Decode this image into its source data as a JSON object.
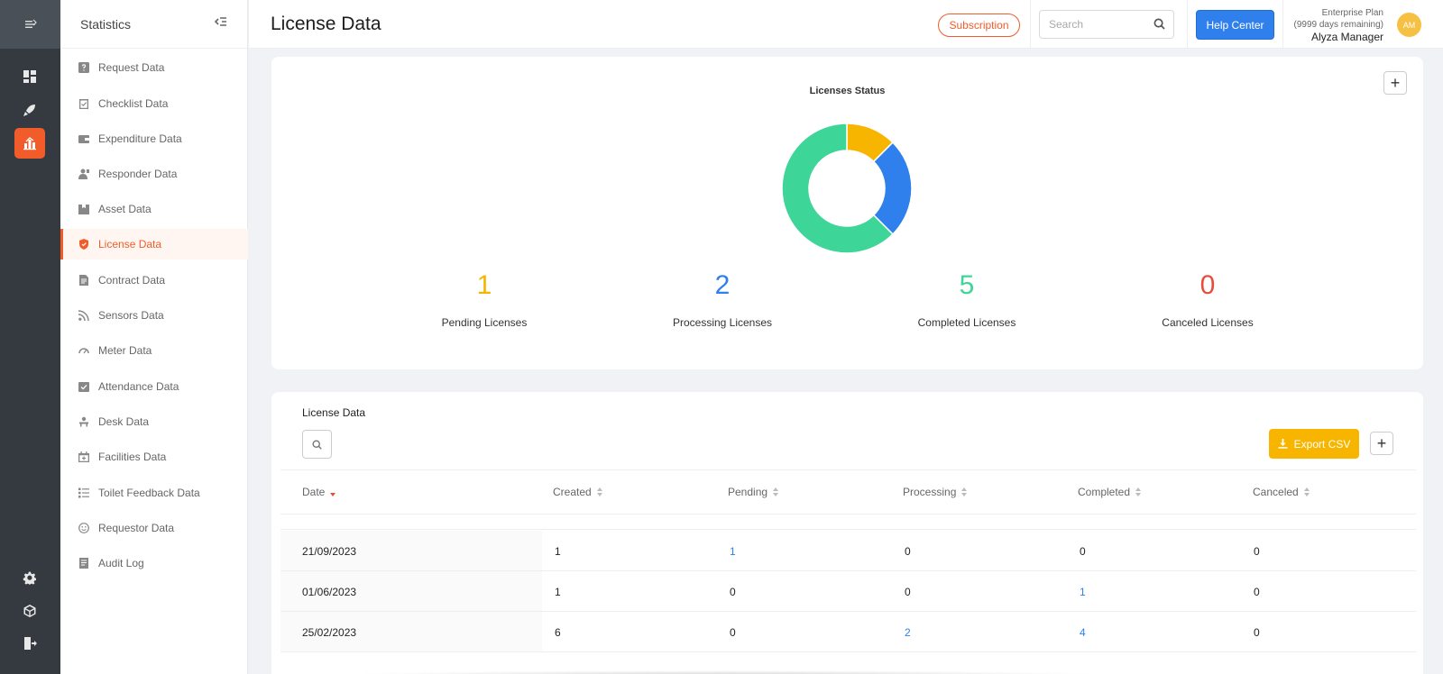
{
  "rail": {
    "items": [
      {
        "icon": "menu-expand-icon"
      },
      {
        "icon": "dashboard-icon"
      },
      {
        "icon": "rocket-icon"
      },
      {
        "icon": "statistics-icon"
      },
      {
        "icon": "gear-icon"
      },
      {
        "icon": "box-icon"
      },
      {
        "icon": "logout-icon"
      }
    ]
  },
  "sidebar": {
    "title": "Statistics",
    "items": [
      {
        "label": "Request Data",
        "icon": "question-icon"
      },
      {
        "label": "Checklist Data",
        "icon": "checklist-icon"
      },
      {
        "label": "Expenditure Data",
        "icon": "wallet-icon"
      },
      {
        "label": "Responder Data",
        "icon": "responder-icon"
      },
      {
        "label": "Asset Data",
        "icon": "asset-icon"
      },
      {
        "label": "License Data",
        "icon": "shield-icon",
        "active": true
      },
      {
        "label": "Contract Data",
        "icon": "contract-icon"
      },
      {
        "label": "Sensors Data",
        "icon": "sensor-icon"
      },
      {
        "label": "Meter Data",
        "icon": "meter-icon"
      },
      {
        "label": "Attendance Data",
        "icon": "attendance-icon"
      },
      {
        "label": "Desk Data",
        "icon": "desk-icon"
      },
      {
        "label": "Facilities Data",
        "icon": "facilities-icon"
      },
      {
        "label": "Toilet Feedback Data",
        "icon": "list-icon"
      },
      {
        "label": "Requestor Data",
        "icon": "smiley-icon"
      },
      {
        "label": "Audit Log",
        "icon": "log-icon"
      }
    ]
  },
  "header": {
    "title": "License Data",
    "subscription_label": "Subscription",
    "search_placeholder": "Search",
    "help_label": "Help Center",
    "plan": "Enterprise Plan",
    "days_remaining": "(9999 days remaining)",
    "user_name": "Alyza Manager",
    "avatar_initials": "AM"
  },
  "status": {
    "chart_title": "Licenses Status",
    "stats": [
      {
        "value": "1",
        "label": "Pending Licenses",
        "color": "#f8b500"
      },
      {
        "value": "2",
        "label": "Processing Licenses",
        "color": "#2f80ed"
      },
      {
        "value": "5",
        "label": "Completed Licenses",
        "color": "#3ed598"
      },
      {
        "value": "0",
        "label": "Canceled Licenses",
        "color": "#e74c3c"
      }
    ]
  },
  "chart_data": {
    "type": "pie",
    "title": "Licenses Status",
    "categories": [
      "Pending",
      "Processing",
      "Completed",
      "Canceled"
    ],
    "values": [
      1,
      2,
      5,
      0
    ],
    "colors": [
      "#f8b500",
      "#2f80ed",
      "#3ed598",
      "#e74c3c"
    ],
    "donut": true
  },
  "table": {
    "title": "License Data",
    "export_label": "Export CSV",
    "columns": [
      "Date",
      "Created",
      "Pending",
      "Processing",
      "Completed",
      "Canceled"
    ],
    "rows": [
      [
        "21/09/2023",
        "1",
        "1",
        "0",
        "0",
        "0"
      ],
      [
        "01/06/2023",
        "1",
        "0",
        "0",
        "1",
        "0"
      ],
      [
        "25/02/2023",
        "6",
        "0",
        "2",
        "4",
        "0"
      ]
    ]
  }
}
